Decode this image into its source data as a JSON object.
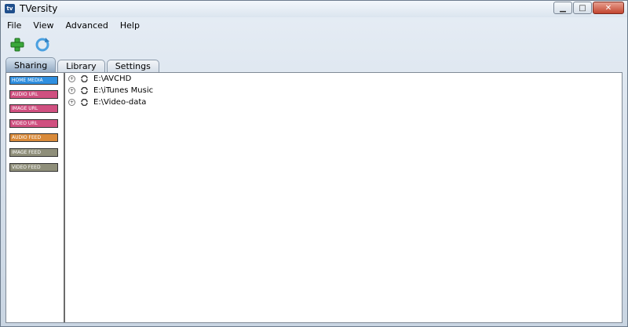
{
  "window": {
    "title": "TVersity"
  },
  "menu": [
    "File",
    "View",
    "Advanced",
    "Help"
  ],
  "tabs": [
    "Sharing",
    "Library",
    "Settings"
  ],
  "sidebar": [
    {
      "label": "HOME  MEDIA",
      "color": "#2f8fe0"
    },
    {
      "label": "AUDIO URL",
      "color": "#d05080"
    },
    {
      "label": "IMAGE URL",
      "color": "#d05080"
    },
    {
      "label": "VIDEO URL",
      "color": "#d05080"
    },
    {
      "label": "AUDIO FEED",
      "color": "#d98a3a"
    },
    {
      "label": "IMAGE FEED",
      "color": "#8f8f7a"
    },
    {
      "label": "VIDEO FEED",
      "color": "#8f8f7a"
    }
  ],
  "tree": [
    "E:\\AVCHD",
    "E:\\iTunes Music",
    "E:\\Video-data"
  ]
}
